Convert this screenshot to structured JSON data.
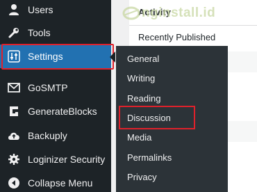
{
  "sidebar": {
    "items": [
      {
        "label": "Users",
        "icon": "users-icon"
      },
      {
        "label": "Tools",
        "icon": "wrench-icon"
      },
      {
        "label": "Settings",
        "icon": "settings-sliders-icon",
        "active": true
      },
      {
        "label": "GoSMTP",
        "icon": "envelope-icon"
      },
      {
        "label": "GenerateBlocks",
        "icon": "generateblocks-icon"
      },
      {
        "label": "Backuply",
        "icon": "cloud-upload-icon"
      },
      {
        "label": "Loginizer Security",
        "icon": "gear-icon"
      },
      {
        "label": "Collapse Menu",
        "icon": "collapse-icon"
      }
    ]
  },
  "submenu": {
    "items": [
      "General",
      "Writing",
      "Reading",
      "Discussion",
      "Media",
      "Permalinks",
      "Privacy"
    ],
    "highlighted": "Discussion"
  },
  "panel": {
    "title": "Activity",
    "subtitle": "Recently Published"
  },
  "watermark": {
    "text": "nginstall.id"
  },
  "colors": {
    "sidebar_bg": "#1d2327",
    "active_bg": "#2271b1",
    "submenu_bg": "#2c3338",
    "highlight_outline": "#e0212b"
  }
}
